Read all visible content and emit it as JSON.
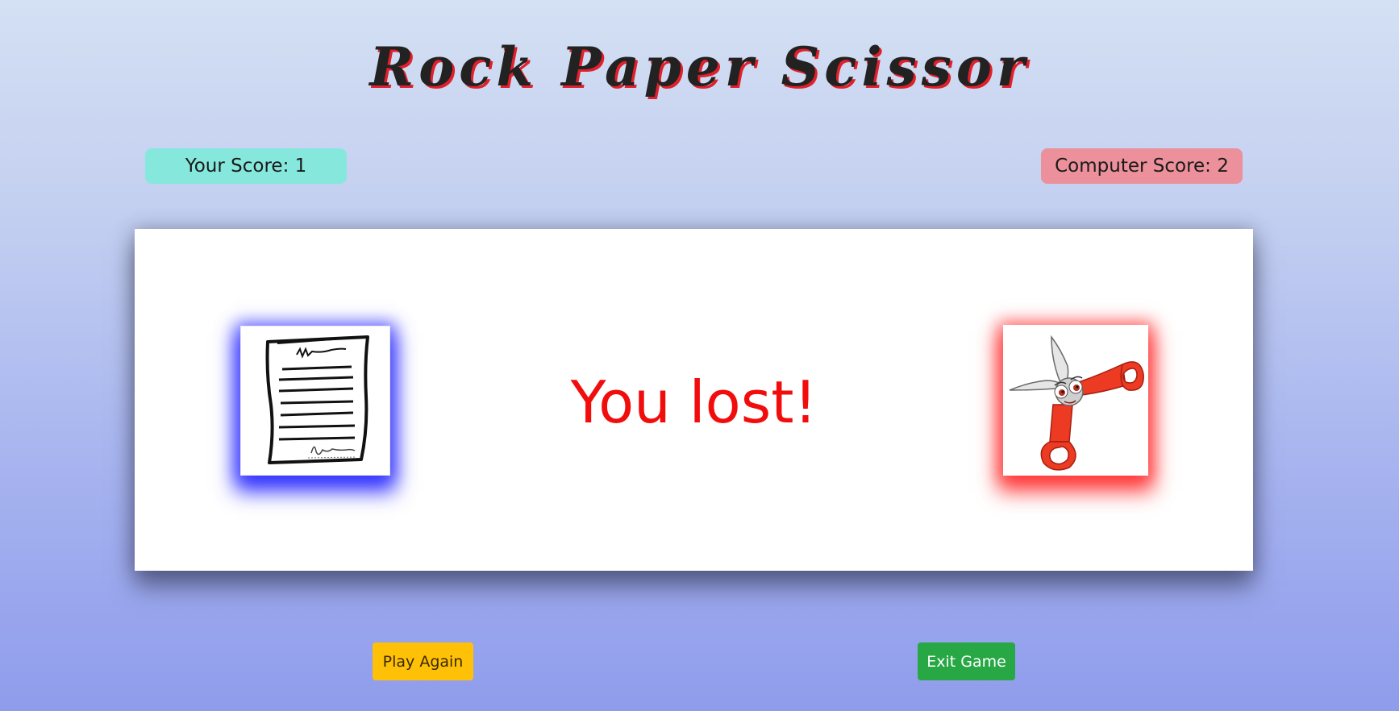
{
  "game": {
    "title": "Rock Paper Scissor"
  },
  "scoreboard": {
    "user_label": "Your Score: 1",
    "user_score": 1,
    "computer_label": "Computer Score: 2",
    "computer_score": 2
  },
  "round": {
    "user_choice_icon": "paper-icon",
    "computer_choice_icon": "scissors-icon",
    "result_text": "You lost!"
  },
  "actions": {
    "play_again_label": "Play Again",
    "exit_label": "Exit Game"
  },
  "colors": {
    "user_glow": "#3232ff",
    "computer_glow": "#ff2828",
    "result": "#f20d0d",
    "user_score_bg": "#86e8dc",
    "computer_score_bg": "#ec909b",
    "play_again_bg": "#ffc107",
    "exit_bg": "#28a745"
  }
}
